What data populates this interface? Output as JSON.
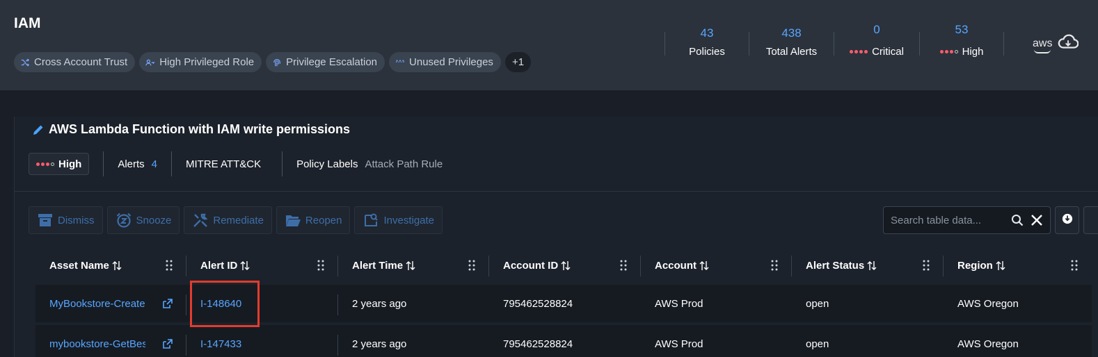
{
  "header": {
    "title": "IAM",
    "chips": [
      {
        "label": "Cross Account Trust",
        "icon": "shuffle-icon"
      },
      {
        "label": "High Privileged Role",
        "icon": "user-key-icon"
      },
      {
        "label": "Privilege Escalation",
        "icon": "fingerprint-icon"
      },
      {
        "label": "Unused Privileges",
        "icon": "dots-icon"
      }
    ],
    "more_chip": "+1",
    "stats": {
      "policies": {
        "value": "43",
        "label": "Policies"
      },
      "total_alerts": {
        "value": "438",
        "label": "Total Alerts"
      },
      "critical": {
        "value": "0",
        "label": "Critical"
      },
      "high": {
        "value": "53",
        "label": "High"
      }
    },
    "cloud_provider": "aws"
  },
  "policy": {
    "title": "AWS Lambda Function with IAM write permissions",
    "severity": "High",
    "alerts_label": "Alerts",
    "alerts_count": "4",
    "mitre_label": "MITRE ATT&CK",
    "labels_label": "Policy Labels",
    "labels_value": "Attack Path Rule"
  },
  "actions": [
    {
      "label": "Dismiss",
      "icon": "archive-icon"
    },
    {
      "label": "Snooze",
      "icon": "alarm-icon"
    },
    {
      "label": "Remediate",
      "icon": "tools-icon"
    },
    {
      "label": "Reopen",
      "icon": "folder-open-icon"
    },
    {
      "label": "Investigate",
      "icon": "investigate-icon"
    }
  ],
  "search": {
    "placeholder": "Search table data..."
  },
  "table": {
    "columns": [
      "Asset Name",
      "Alert ID",
      "Alert Time",
      "Account ID",
      "Account",
      "Alert Status",
      "Region"
    ],
    "rows": [
      {
        "asset": "MyBookstore-CreateBook",
        "alert_id": "I-148640",
        "time": "2 years ago",
        "account_id": "795462528824",
        "account": "AWS Prod",
        "status": "open",
        "region": "AWS Oregon"
      },
      {
        "asset": "mybookstore-GetBestSellers",
        "alert_id": "I-147433",
        "time": "2 years ago",
        "account_id": "795462528824",
        "account": "AWS Prod",
        "status": "open",
        "region": "AWS Oregon"
      }
    ]
  },
  "colors": {
    "accent": "#58a6ff",
    "critical": "#ff5c6c",
    "highlight_box": "#e33b2e",
    "header_bg": "#2b323c"
  }
}
